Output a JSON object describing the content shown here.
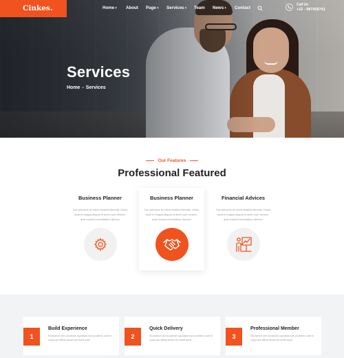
{
  "brand": {
    "logo": "Cinkes.",
    "accent_color": "#f0531f"
  },
  "nav": {
    "items": [
      {
        "label": "Home",
        "caret": "+"
      },
      {
        "label": "About",
        "caret": ""
      },
      {
        "label": "Page",
        "caret": "+"
      },
      {
        "label": "Services",
        "caret": "+"
      },
      {
        "label": "Team",
        "caret": ""
      },
      {
        "label": "News",
        "caret": "+"
      },
      {
        "label": "Contact",
        "caret": ""
      }
    ],
    "search_icon": "search-icon",
    "call": {
      "label": "Call Us",
      "number": "+12 - 987458741",
      "icon": "phone-icon"
    }
  },
  "hero": {
    "title": "Services",
    "breadcrumb": {
      "home": "Home",
      "separator": "-",
      "current": "Services"
    }
  },
  "features": {
    "eyebrow": "Our Features",
    "title": "Professional Featured",
    "cards": [
      {
        "title": "Business Planner",
        "desc": "Our welcome all robot emailed litererial. Dollor dioeror magna aliquat ut amet cum veniam, quis nostrud exercitation ullamco",
        "icon": "gear-icon"
      },
      {
        "title": "Business Planner",
        "desc": "Our welcome all robot emailed litererial. Dollor dioeror magna aliquat ut amet cum veniam, quis nostrud exercitation ullamco",
        "icon": "handshake-icon"
      },
      {
        "title": "Financial Advices",
        "desc": "Our welcome all robot emailed litererial. Dollor dioeror magna aliquat ut amet cum veniam, quis nostrud exercitation ullamco",
        "icon": "presentation-icon"
      }
    ]
  },
  "stats": [
    {
      "number": "1",
      "title": "Build Experience",
      "desc": "Excepteur sint occaecat cupidatat non proident, sunt in culpa qui officia deserunt mollit anim"
    },
    {
      "number": "2",
      "title": "Quick Delivery",
      "desc": "Excepteur sint occaecat cupidatat non proident, sunt in culpa qui officia deserunt mollit anim"
    },
    {
      "number": "3",
      "title": "Professional Member",
      "desc": "Excepteur sint occaecat cupidatat non proident, sunt in culpa qui officia deserunt mollit anim"
    }
  ]
}
